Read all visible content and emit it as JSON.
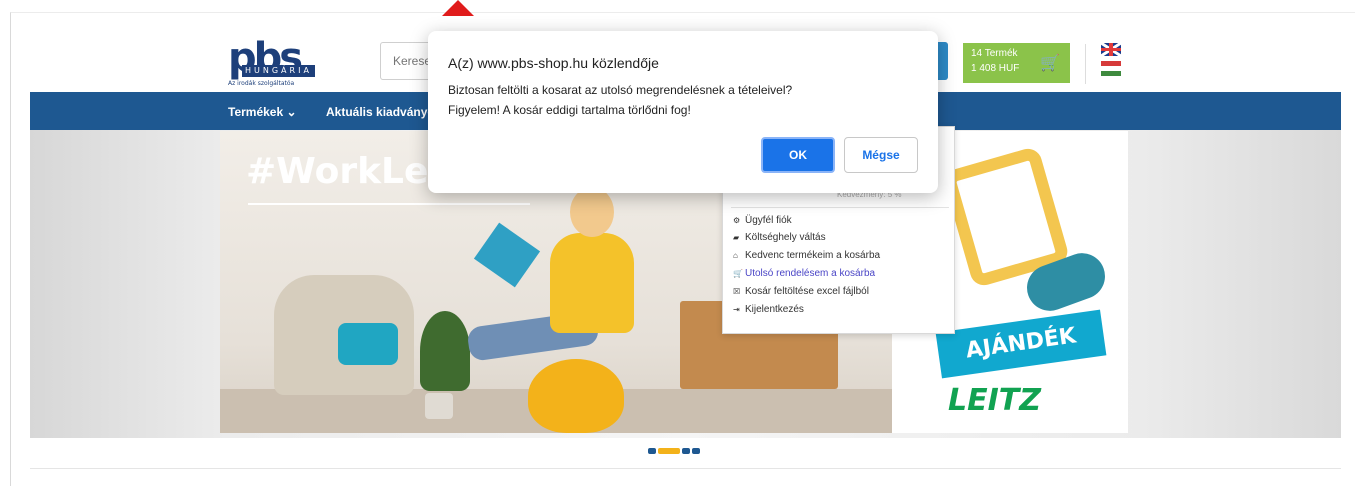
{
  "header": {
    "logo": {
      "text": "pbs",
      "sub": "HUNGÁRIA",
      "tagline": "Az irodák szolgáltatóa"
    },
    "search": {
      "placeholder": "Kerese"
    },
    "cart": {
      "line1": "14 Termék",
      "line2": "1 408 HUF"
    },
    "languages": [
      "en",
      "hu"
    ]
  },
  "nav": {
    "items": [
      {
        "label": "Termékek ⌄"
      },
      {
        "label": "Aktuális kiadványo"
      }
    ]
  },
  "banner": {
    "hashtag": "#WorkLeitzE",
    "gift": "AJÁNDÉK",
    "brand": "LEITZ"
  },
  "account_menu": {
    "faded_text": "Kedvezmény: 5 %",
    "items": [
      {
        "icon": "gear-icon",
        "label": "Ügyfél fiók"
      },
      {
        "icon": "truck-icon",
        "label": "Költséghely váltás"
      },
      {
        "icon": "home-icon",
        "label": "Kedvenc termékeim a kosárba"
      },
      {
        "icon": "cart-icon",
        "label": "Utolsó rendelésem a kosárba",
        "active": true
      },
      {
        "icon": "excel-icon",
        "label": "Kosár feltöltése excel fájlból"
      },
      {
        "icon": "logout-icon",
        "label": "Kijelentkezés"
      }
    ]
  },
  "dialog": {
    "title": "A(z) www.pbs-shop.hu közlendője",
    "line1": "Biztosan feltölti a kosarat az utolsó megrendelésnek a tételeivel?",
    "line2": "Figyelem! A kosár eddigi tartalma törlődni fog!",
    "ok": "OK",
    "cancel": "Mégse"
  },
  "carousel": {
    "slides": 4,
    "active": 2
  },
  "colors": {
    "nav_bg": "#1e5891",
    "cart_bg": "#8bc34a",
    "ok_button": "#1a73e8",
    "annotation_arrow": "#e01b1b"
  }
}
